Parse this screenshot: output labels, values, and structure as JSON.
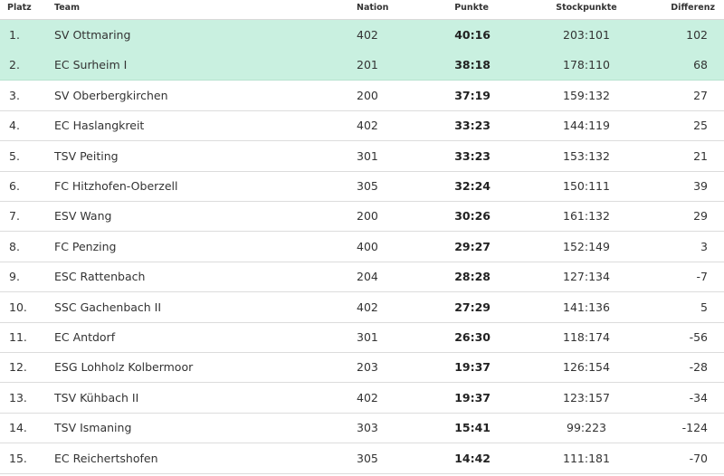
{
  "headers": {
    "platz": "Platz",
    "team": "Team",
    "nation": "Nation",
    "punkte": "Punkte",
    "stockpunkte": "Stockpunkte",
    "differenz": "Differenz"
  },
  "colors": {
    "highlight": "#c9f0e0"
  },
  "rows": [
    {
      "platz": "1.",
      "team": "SV Ottmaring",
      "nation": "402",
      "punkte": "40:16",
      "stockpunkte": "203:101",
      "differenz": "102",
      "highlight": true
    },
    {
      "platz": "2.",
      "team": "EC Surheim I",
      "nation": "201",
      "punkte": "38:18",
      "stockpunkte": "178:110",
      "differenz": "68",
      "highlight": true
    },
    {
      "platz": "3.",
      "team": "SV Oberbergkirchen",
      "nation": "200",
      "punkte": "37:19",
      "stockpunkte": "159:132",
      "differenz": "27",
      "highlight": false
    },
    {
      "platz": "4.",
      "team": "EC Haslangkreit",
      "nation": "402",
      "punkte": "33:23",
      "stockpunkte": "144:119",
      "differenz": "25",
      "highlight": false
    },
    {
      "platz": "5.",
      "team": "TSV Peiting",
      "nation": "301",
      "punkte": "33:23",
      "stockpunkte": "153:132",
      "differenz": "21",
      "highlight": false
    },
    {
      "platz": "6.",
      "team": "FC Hitzhofen-Oberzell",
      "nation": "305",
      "punkte": "32:24",
      "stockpunkte": "150:111",
      "differenz": "39",
      "highlight": false
    },
    {
      "platz": "7.",
      "team": "ESV Wang",
      "nation": "200",
      "punkte": "30:26",
      "stockpunkte": "161:132",
      "differenz": "29",
      "highlight": false
    },
    {
      "platz": "8.",
      "team": "FC Penzing",
      "nation": "400",
      "punkte": "29:27",
      "stockpunkte": "152:149",
      "differenz": "3",
      "highlight": false
    },
    {
      "platz": "9.",
      "team": "ESC Rattenbach",
      "nation": "204",
      "punkte": "28:28",
      "stockpunkte": "127:134",
      "differenz": "-7",
      "highlight": false
    },
    {
      "platz": "10.",
      "team": "SSC Gachenbach II",
      "nation": "402",
      "punkte": "27:29",
      "stockpunkte": "141:136",
      "differenz": "5",
      "highlight": false
    },
    {
      "platz": "11.",
      "team": "EC Antdorf",
      "nation": "301",
      "punkte": "26:30",
      "stockpunkte": "118:174",
      "differenz": "-56",
      "highlight": false
    },
    {
      "platz": "12.",
      "team": "ESG Lohholz Kolbermoor",
      "nation": "203",
      "punkte": "19:37",
      "stockpunkte": "126:154",
      "differenz": "-28",
      "highlight": false
    },
    {
      "platz": "13.",
      "team": "TSV Kühbach II",
      "nation": "402",
      "punkte": "19:37",
      "stockpunkte": "123:157",
      "differenz": "-34",
      "highlight": false
    },
    {
      "platz": "14.",
      "team": "TSV Ismaning",
      "nation": "303",
      "punkte": "15:41",
      "stockpunkte": "99:223",
      "differenz": "-124",
      "highlight": false
    },
    {
      "platz": "15.",
      "team": "EC Reichertshofen",
      "nation": "305",
      "punkte": "14:42",
      "stockpunkte": "111:181",
      "differenz": "-70",
      "highlight": false
    }
  ]
}
